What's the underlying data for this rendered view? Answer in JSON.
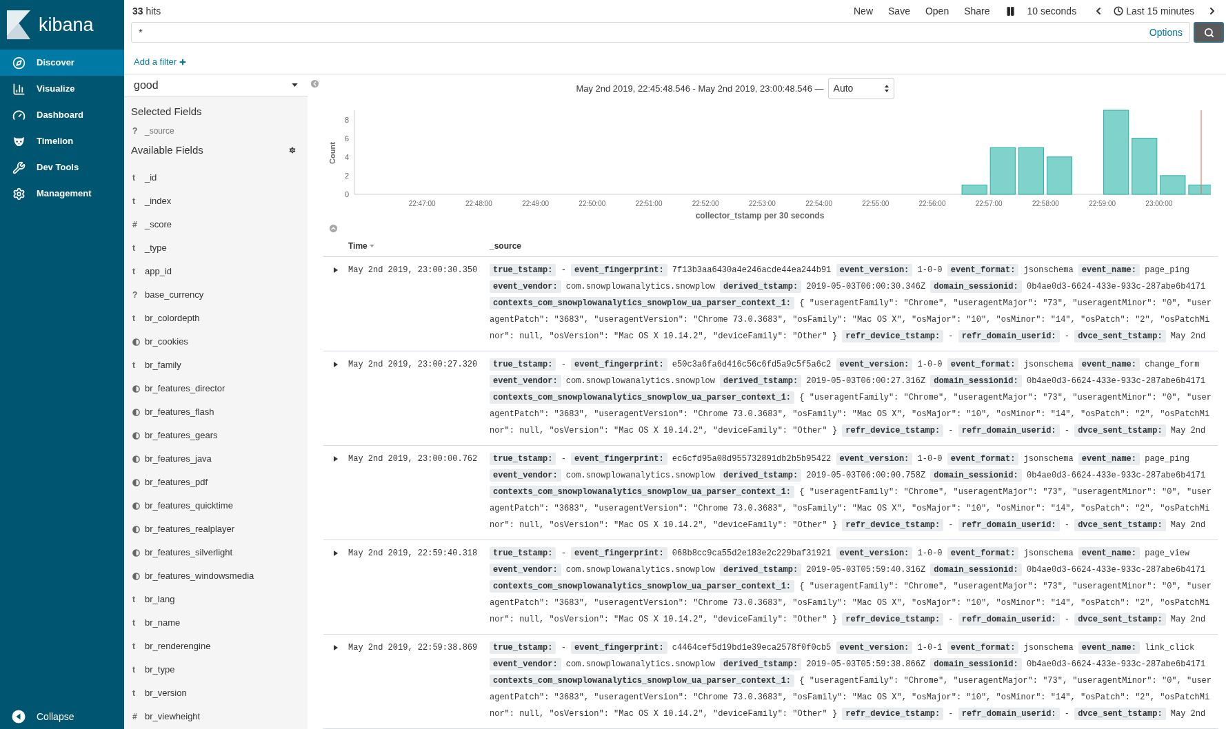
{
  "sidebar": {
    "logo_text": "kibana",
    "items": [
      {
        "label": "Discover",
        "selected": true
      },
      {
        "label": "Visualize",
        "selected": false
      },
      {
        "label": "Dashboard",
        "selected": false
      },
      {
        "label": "Timelion",
        "selected": false
      },
      {
        "label": "Dev Tools",
        "selected": false
      },
      {
        "label": "Management",
        "selected": false
      }
    ],
    "collapse": "Collapse"
  },
  "top_bar": {
    "hits_count": "33",
    "hits_label": "hits",
    "menu": [
      "New",
      "Save",
      "Open",
      "Share"
    ],
    "refresh_interval": "10 seconds",
    "time_range": "Last 15 minutes"
  },
  "query": {
    "value": "*",
    "options": "Options"
  },
  "filter_bar": {
    "add_filter": "Add a filter"
  },
  "index_pattern": {
    "value": "good"
  },
  "fields": {
    "selected_heading": "Selected Fields",
    "selected": [
      {
        "kind": "text",
        "symbol": "?",
        "name": "_source"
      }
    ],
    "available_heading": "Available Fields",
    "available": [
      {
        "kind": "text",
        "symbol": "t",
        "name": "_id"
      },
      {
        "kind": "text",
        "symbol": "t",
        "name": "_index"
      },
      {
        "kind": "text",
        "symbol": "#",
        "name": "_score"
      },
      {
        "kind": "text",
        "symbol": "t",
        "name": "_type"
      },
      {
        "kind": "text",
        "symbol": "t",
        "name": "app_id"
      },
      {
        "kind": "text",
        "symbol": "?",
        "name": "base_currency"
      },
      {
        "kind": "text",
        "symbol": "t",
        "name": "br_colordepth"
      },
      {
        "kind": "boolean",
        "name": "br_cookies"
      },
      {
        "kind": "text",
        "symbol": "t",
        "name": "br_family"
      },
      {
        "kind": "boolean",
        "name": "br_features_director"
      },
      {
        "kind": "boolean",
        "name": "br_features_flash"
      },
      {
        "kind": "boolean",
        "name": "br_features_gears"
      },
      {
        "kind": "boolean",
        "name": "br_features_java"
      },
      {
        "kind": "boolean",
        "name": "br_features_pdf"
      },
      {
        "kind": "boolean",
        "name": "br_features_quicktime"
      },
      {
        "kind": "boolean",
        "name": "br_features_realplayer"
      },
      {
        "kind": "boolean",
        "name": "br_features_silverlight"
      },
      {
        "kind": "boolean",
        "name": "br_features_windowsmedia"
      },
      {
        "kind": "text",
        "symbol": "t",
        "name": "br_lang"
      },
      {
        "kind": "text",
        "symbol": "t",
        "name": "br_name"
      },
      {
        "kind": "text",
        "symbol": "t",
        "name": "br_renderengine"
      },
      {
        "kind": "text",
        "symbol": "t",
        "name": "br_type"
      },
      {
        "kind": "text",
        "symbol": "t",
        "name": "br_version"
      },
      {
        "kind": "text",
        "symbol": "#",
        "name": "br_viewheight"
      }
    ]
  },
  "histogram": {
    "range": "May 2nd 2019, 22:45:48.546 - May 2nd 2019, 23:00:48.546 —",
    "interval": "Auto",
    "chart_data": {
      "type": "bar",
      "xlabel": "collector_tstamp per 30 seconds",
      "ylabel": "Count",
      "categories": [
        null,
        null,
        "22:47:00",
        null,
        "22:48:00",
        null,
        "22:49:00",
        null,
        "22:50:00",
        null,
        "22:51:00",
        null,
        "22:52:00",
        null,
        "22:53:00",
        null,
        "22:54:00",
        null,
        "22:55:00",
        null,
        "22:56:00",
        null,
        "22:57:00",
        null,
        "22:58:00",
        null,
        "22:59:00",
        null,
        "23:00:00",
        null
      ],
      "series": [
        {
          "color": "#80d3cb",
          "values": [
            0,
            0,
            0,
            0,
            0,
            0,
            0,
            0,
            0,
            0,
            0,
            0,
            0,
            0,
            0,
            0,
            0,
            0,
            0,
            0,
            0,
            1,
            5,
            5,
            4,
            0,
            9,
            6,
            2,
            1
          ]
        }
      ],
      "ylim": [
        0,
        9
      ],
      "yticks": [
        0,
        2,
        4,
        6,
        8
      ]
    }
  },
  "table": {
    "columns": [
      "Time",
      "_source"
    ],
    "rows": [
      {
        "time": "May 2nd 2019, 23:00:30.350",
        "expanded": false,
        "fields": [
          {
            "key": "true_tstamp:",
            "value": "-"
          },
          {
            "key": "event_fingerprint:",
            "value": "7f13b3aa6430a4e246acde44ea244b91"
          },
          {
            "key": "event_version:",
            "value": "1-0-0"
          },
          {
            "key": "event_format:",
            "value": "jsonschema"
          },
          {
            "key": "event_name:",
            "value": "page_ping"
          },
          {
            "key": "event_vendor:",
            "value": "com.snowplowanalytics.snowplow"
          },
          {
            "key": "derived_tstamp:",
            "value": "2019-05-03T06:00:30.346Z"
          },
          {
            "key": "domain_sessionid:",
            "value": "0b4ae0d3-6624-433e-933c-287abe6b4171"
          },
          {
            "key": "contexts_com_snowplowanalytics_snowplow_ua_parser_context_1:",
            "value": "{ \"useragentFamily\": \"Chrome\", \"useragentMajor\": \"73\", \"useragentMinor\": \"0\", \"useragentPatch\": \"3683\", \"useragentVersion\": \"Chrome 73.0.3683\", \"osFamily\": \"Mac OS X\", \"osMajor\": \"10\", \"osMinor\": \"14\", \"osPatch\": \"2\", \"osPatchMinor\": null, \"osVersion\": \"Mac OS X 10.14.2\", \"deviceFamily\": \"Other\" }"
          },
          {
            "key": "refr_device_tstamp:",
            "value": "-"
          },
          {
            "key": "refr_domain_userid:",
            "value": "-"
          },
          {
            "key": "dvce_sent_tstamp:",
            "value": "May 2nd"
          }
        ]
      },
      {
        "time": "May 2nd 2019, 23:00:27.320",
        "expanded": false,
        "fields": [
          {
            "key": "true_tstamp:",
            "value": "-"
          },
          {
            "key": "event_fingerprint:",
            "value": "e50c3a6fa6d416c56c6fd5a9c5f5a6c2"
          },
          {
            "key": "event_version:",
            "value": "1-0-0"
          },
          {
            "key": "event_format:",
            "value": "jsonschema"
          },
          {
            "key": "event_name:",
            "value": "change_form"
          },
          {
            "key": "event_vendor:",
            "value": "com.snowplowanalytics.snowplow"
          },
          {
            "key": "derived_tstamp:",
            "value": "2019-05-03T06:00:27.316Z"
          },
          {
            "key": "domain_sessionid:",
            "value": "0b4ae0d3-6624-433e-933c-287abe6b4171"
          },
          {
            "key": "contexts_com_snowplowanalytics_snowplow_ua_parser_context_1:",
            "value": "{ \"useragentFamily\": \"Chrome\", \"useragentMajor\": \"73\", \"useragentMinor\": \"0\", \"useragentPatch\": \"3683\", \"useragentVersion\": \"Chrome 73.0.3683\", \"osFamily\": \"Mac OS X\", \"osMajor\": \"10\", \"osMinor\": \"14\", \"osPatch\": \"2\", \"osPatchMinor\": null, \"osVersion\": \"Mac OS X 10.14.2\", \"deviceFamily\": \"Other\" }"
          },
          {
            "key": "refr_device_tstamp:",
            "value": "-"
          },
          {
            "key": "refr_domain_userid:",
            "value": "-"
          },
          {
            "key": "dvce_sent_tstamp:",
            "value": "May 2nd"
          }
        ]
      },
      {
        "time": "May 2nd 2019, 23:00:00.762",
        "expanded": false,
        "fields": [
          {
            "key": "true_tstamp:",
            "value": "-"
          },
          {
            "key": "event_fingerprint:",
            "value": "ec6cfd95a08d955732891db2b5b95422"
          },
          {
            "key": "event_version:",
            "value": "1-0-0"
          },
          {
            "key": "event_format:",
            "value": "jsonschema"
          },
          {
            "key": "event_name:",
            "value": "page_ping"
          },
          {
            "key": "event_vendor:",
            "value": "com.snowplowanalytics.snowplow"
          },
          {
            "key": "derived_tstamp:",
            "value": "2019-05-03T06:00:00.758Z"
          },
          {
            "key": "domain_sessionid:",
            "value": "0b4ae0d3-6624-433e-933c-287abe6b4171"
          },
          {
            "key": "contexts_com_snowplowanalytics_snowplow_ua_parser_context_1:",
            "value": "{ \"useragentFamily\": \"Chrome\", \"useragentMajor\": \"73\", \"useragentMinor\": \"0\", \"useragentPatch\": \"3683\", \"useragentVersion\": \"Chrome 73.0.3683\", \"osFamily\": \"Mac OS X\", \"osMajor\": \"10\", \"osMinor\": \"14\", \"osPatch\": \"2\", \"osPatchMinor\": null, \"osVersion\": \"Mac OS X 10.14.2\", \"deviceFamily\": \"Other\" }"
          },
          {
            "key": "refr_device_tstamp:",
            "value": "-"
          },
          {
            "key": "refr_domain_userid:",
            "value": "-"
          },
          {
            "key": "dvce_sent_tstamp:",
            "value": "May 2nd"
          }
        ]
      },
      {
        "time": "May 2nd 2019, 22:59:40.318",
        "expanded": false,
        "fields": [
          {
            "key": "true_tstamp:",
            "value": "-"
          },
          {
            "key": "event_fingerprint:",
            "value": "068b8cc9ca55d2e183e2c229baf31921"
          },
          {
            "key": "event_version:",
            "value": "1-0-0"
          },
          {
            "key": "event_format:",
            "value": "jsonschema"
          },
          {
            "key": "event_name:",
            "value": "page_view"
          },
          {
            "key": "event_vendor:",
            "value": "com.snowplowanalytics.snowplow"
          },
          {
            "key": "derived_tstamp:",
            "value": "2019-05-03T05:59:40.316Z"
          },
          {
            "key": "domain_sessionid:",
            "value": "0b4ae0d3-6624-433e-933c-287abe6b4171"
          },
          {
            "key": "contexts_com_snowplowanalytics_snowplow_ua_parser_context_1:",
            "value": "{ \"useragentFamily\": \"Chrome\", \"useragentMajor\": \"73\", \"useragentMinor\": \"0\", \"useragentPatch\": \"3683\", \"useragentVersion\": \"Chrome 73.0.3683\", \"osFamily\": \"Mac OS X\", \"osMajor\": \"10\", \"osMinor\": \"14\", \"osPatch\": \"2\", \"osPatchMinor\": null, \"osVersion\": \"Mac OS X 10.14.2\", \"deviceFamily\": \"Other\" }"
          },
          {
            "key": "refr_device_tstamp:",
            "value": "-"
          },
          {
            "key": "refr_domain_userid:",
            "value": "-"
          },
          {
            "key": "dvce_sent_tstamp:",
            "value": "May 2nd"
          }
        ]
      },
      {
        "time": "May 2nd 2019, 22:59:38.869",
        "expanded": false,
        "fields": [
          {
            "key": "true_tstamp:",
            "value": "-"
          },
          {
            "key": "event_fingerprint:",
            "value": "c4464cef5d19bd1e39eca2578f0f0cb5"
          },
          {
            "key": "event_version:",
            "value": "1-0-1"
          },
          {
            "key": "event_format:",
            "value": "jsonschema"
          },
          {
            "key": "event_name:",
            "value": "link_click"
          },
          {
            "key": "event_vendor:",
            "value": "com.snowplowanalytics.snowplow"
          },
          {
            "key": "derived_tstamp:",
            "value": "2019-05-03T05:59:38.866Z"
          },
          {
            "key": "domain_sessionid:",
            "value": "0b4ae0d3-6624-433e-933c-287abe6b4171"
          },
          {
            "key": "contexts_com_snowplowanalytics_snowplow_ua_parser_context_1:",
            "value": "{ \"useragentFamily\": \"Chrome\", \"useragentMajor\": \"73\", \"useragentMinor\": \"0\", \"useragentPatch\": \"3683\", \"useragentVersion\": \"Chrome 73.0.3683\", \"osFamily\": \"Mac OS X\", \"osMajor\": \"10\", \"osMinor\": \"14\", \"osPatch\": \"2\", \"osPatchMinor\": null, \"osVersion\": \"Mac OS X 10.14.2\", \"deviceFamily\": \"Other\" }"
          },
          {
            "key": "refr_device_tstamp:",
            "value": "-"
          },
          {
            "key": "refr_domain_userid:",
            "value": "-"
          },
          {
            "key": "dvce_sent_tstamp:",
            "value": "May 2nd"
          }
        ]
      }
    ]
  }
}
